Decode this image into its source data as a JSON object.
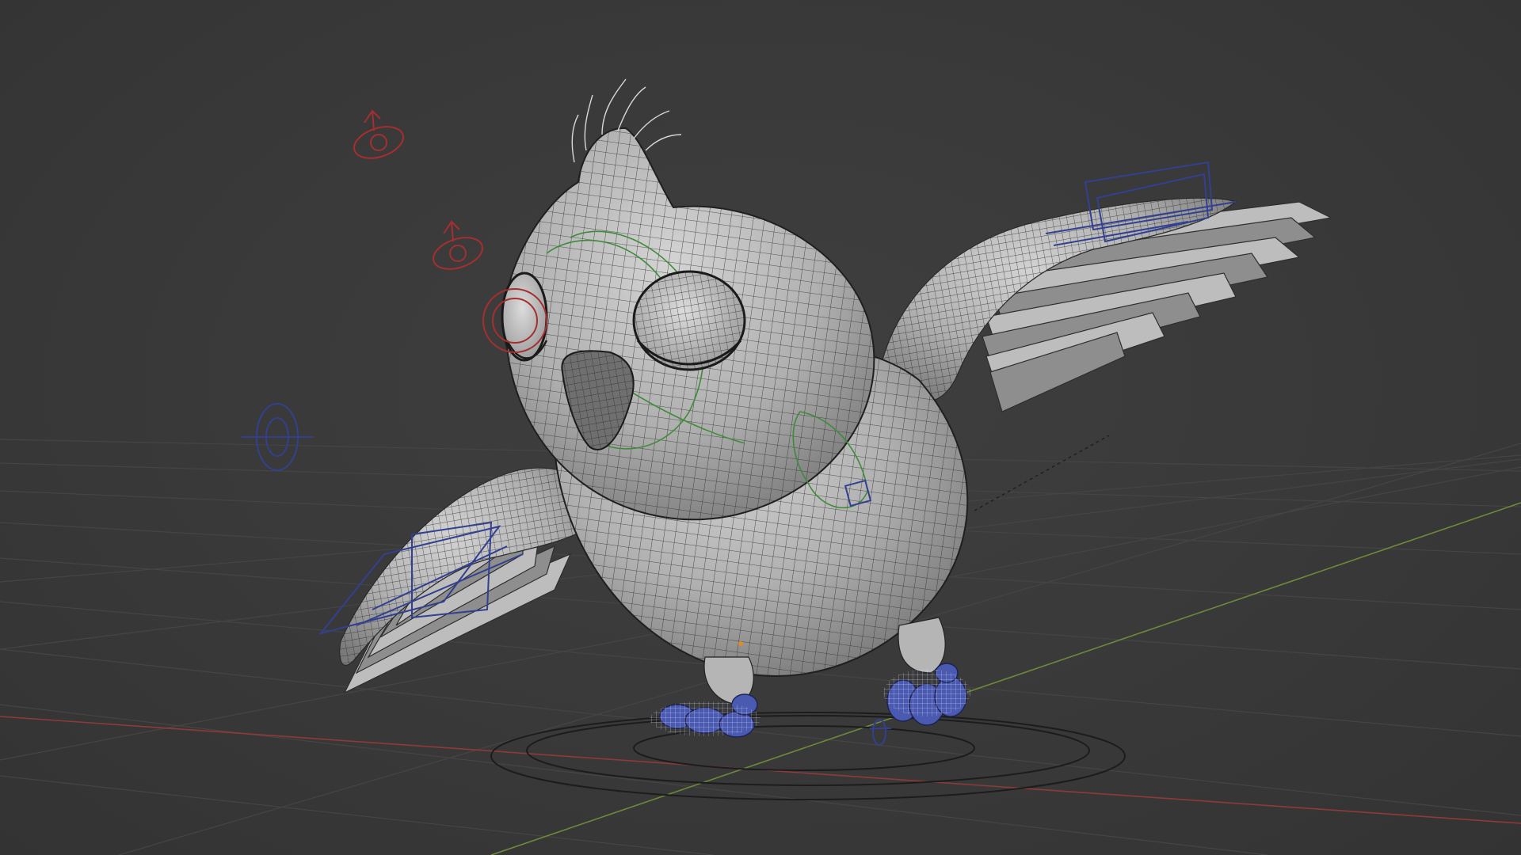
{
  "viewport": {
    "background": "#393939",
    "grid_color": "#454545",
    "x_axis_color": "#8f3a3a",
    "y_axis_color": "#6c8a3a"
  },
  "model": {
    "body_color": "#b4b4b4",
    "wire_color": "#2a2a2a",
    "feather_color": "#bdbdbd",
    "foot_color": "#4a5ab0"
  },
  "controls": {
    "camera_color": "#a52f2f",
    "ik_color": "#33408f",
    "deform_color": "#3f8b3a",
    "icons": [
      "eye-target-icon",
      "pole-target-icon",
      "root-ring-icon"
    ]
  }
}
